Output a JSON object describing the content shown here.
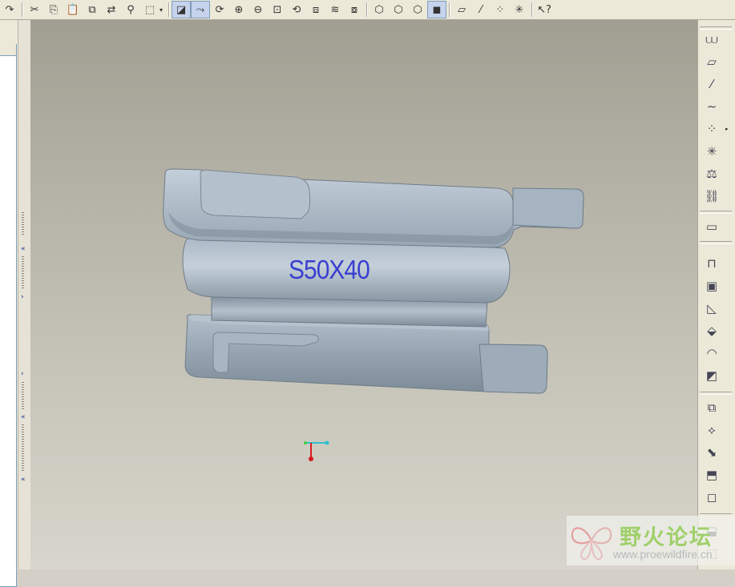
{
  "toolbar": {
    "buttons": [
      {
        "name": "redo-icon",
        "glyph": "↷"
      },
      {
        "name": "cut-icon",
        "glyph": "✂"
      },
      {
        "name": "copy-icon",
        "glyph": "⎘"
      },
      {
        "name": "paste-icon",
        "glyph": "📋"
      },
      {
        "name": "paste-special-icon",
        "glyph": "⧉"
      },
      {
        "name": "regenerate-icon",
        "glyph": "⇄"
      },
      {
        "name": "find-icon",
        "glyph": "⚲"
      },
      {
        "name": "select-box-icon",
        "glyph": "⬚"
      },
      {
        "name": "repaint-icon",
        "glyph": "◪"
      },
      {
        "name": "spin-center-icon",
        "glyph": "⤳"
      },
      {
        "name": "orient-icon",
        "glyph": "⟳"
      },
      {
        "name": "zoom-in-icon",
        "glyph": "⊕"
      },
      {
        "name": "zoom-out-icon",
        "glyph": "⊖"
      },
      {
        "name": "refit-icon",
        "glyph": "⊡"
      },
      {
        "name": "reorient-icon",
        "glyph": "⟲"
      },
      {
        "name": "saved-views-icon",
        "glyph": "⧈"
      },
      {
        "name": "layers-icon",
        "glyph": "≋"
      },
      {
        "name": "view-manager-icon",
        "glyph": "⧇"
      },
      {
        "name": "wireframe-icon",
        "glyph": "⬡"
      },
      {
        "name": "hidden-line-icon",
        "glyph": "⬡"
      },
      {
        "name": "no-hidden-icon",
        "glyph": "⬡"
      },
      {
        "name": "shading-icon",
        "glyph": "◼"
      },
      {
        "name": "plane-display-icon",
        "glyph": "▱"
      },
      {
        "name": "axis-display-icon",
        "glyph": "⁄"
      },
      {
        "name": "point-display-icon",
        "glyph": "⁘"
      },
      {
        "name": "csys-display-icon",
        "glyph": "✳"
      },
      {
        "name": "context-help-icon",
        "glyph": "↖?"
      }
    ]
  },
  "model": {
    "label": "S50X40"
  },
  "right_toolbar": {
    "buttons": [
      {
        "name": "sketch-tool-icon",
        "glyph": "⩊"
      },
      {
        "name": "datum-plane-icon",
        "glyph": "▱"
      },
      {
        "name": "datum-axis-icon",
        "glyph": "⁄"
      },
      {
        "name": "datum-curve-icon",
        "glyph": "∼"
      },
      {
        "name": "datum-point-icon",
        "glyph": "⁘"
      },
      {
        "name": "datum-csys-icon",
        "glyph": "✳"
      },
      {
        "name": "analysis-icon",
        "glyph": "⚖"
      },
      {
        "name": "chain-icon",
        "glyph": "⛓"
      },
      {
        "name": "annotation-icon",
        "glyph": "▭"
      },
      {
        "name": "extrude-icon",
        "glyph": "⊓"
      },
      {
        "name": "shell-icon",
        "glyph": "▣"
      },
      {
        "name": "rib-icon",
        "glyph": "◺"
      },
      {
        "name": "draft-icon",
        "glyph": "⬙"
      },
      {
        "name": "round-icon",
        "glyph": "◠"
      },
      {
        "name": "chamfer-icon",
        "glyph": "◩"
      },
      {
        "name": "copy-feature-icon",
        "glyph": "⧉"
      },
      {
        "name": "mirror-icon",
        "glyph": "⟡"
      },
      {
        "name": "merge-icon",
        "glyph": "⬊"
      },
      {
        "name": "trim-icon",
        "glyph": "⬒"
      },
      {
        "name": "offset-icon",
        "glyph": "◻"
      },
      {
        "name": "thicken-icon",
        "glyph": "⬓"
      },
      {
        "name": "solidify-icon",
        "glyph": "⬚"
      }
    ]
  },
  "watermark": {
    "title": "野火论坛",
    "url": "www.proewildfire.cn"
  }
}
